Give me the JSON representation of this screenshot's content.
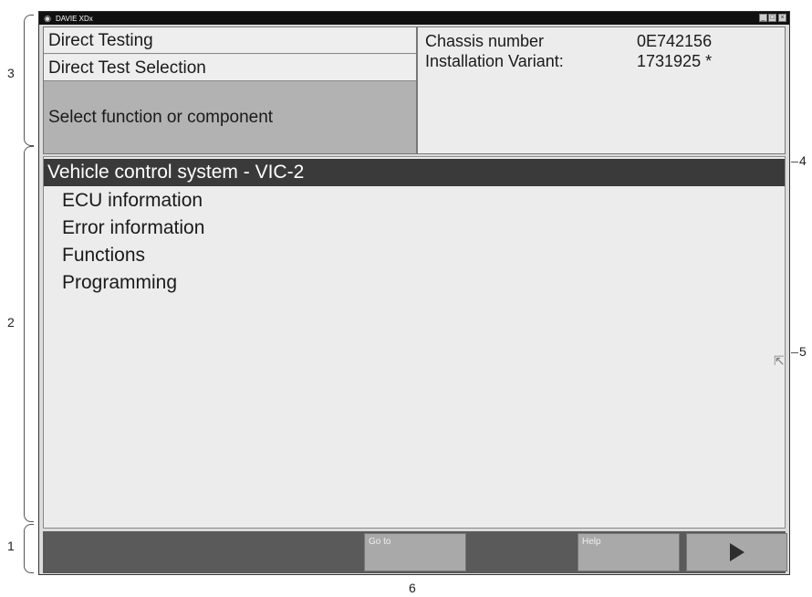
{
  "window": {
    "title": "DAVIE XDx",
    "app_icon": "car-icon",
    "controls": [
      "minimize-icon",
      "maximize-icon",
      "close-icon"
    ]
  },
  "header": {
    "nav": {
      "item1": "Direct Testing",
      "item2": "Direct Test Selection",
      "selected": "Select function or component"
    },
    "info": {
      "chassis_label": "Chassis number",
      "chassis_value": "0E742156",
      "variant_label": "Installation Variant:",
      "variant_value": "1731925 *"
    }
  },
  "list": {
    "header": "Vehicle control system - VIC-2",
    "items": [
      "ECU information",
      "Error information",
      "Functions",
      "Programming"
    ]
  },
  "bottom_bar": {
    "goto_label": "Go to",
    "help_label": "Help",
    "next_icon": "play-icon"
  },
  "callouts": {
    "c1": "1",
    "c2": "2",
    "c3": "3",
    "c4": "4",
    "c5": "5",
    "c6": "6"
  },
  "colors": {
    "list_header_bg": "#3a3a3a",
    "selected_nav_bg": "#b2b2b2",
    "bottom_bar_bg": "#5a5a5a"
  }
}
